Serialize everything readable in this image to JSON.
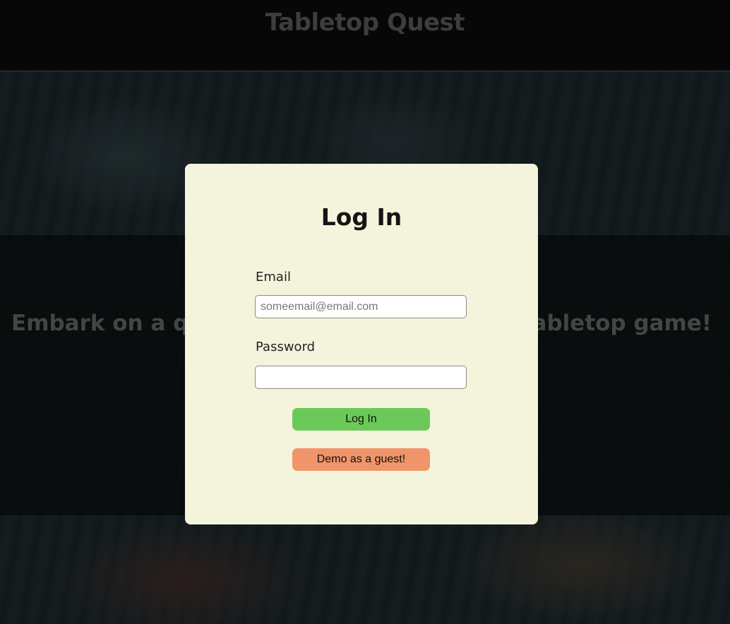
{
  "header": {
    "title": "Tabletop Quest"
  },
  "hero": {
    "text_left": "Embark on a qu",
    "text_right": "tabletop game!"
  },
  "login": {
    "title": "Log In",
    "email_label": "Email",
    "email_placeholder": "someemail@email.com",
    "email_value": "",
    "password_label": "Password",
    "password_value": "",
    "login_button": "Log In",
    "demo_button": "Demo as a guest!"
  },
  "colors": {
    "modal_bg": "#f4f4dc",
    "login_button": "#6bc95a",
    "demo_button": "#f0956a",
    "header_bg": "#070707"
  }
}
